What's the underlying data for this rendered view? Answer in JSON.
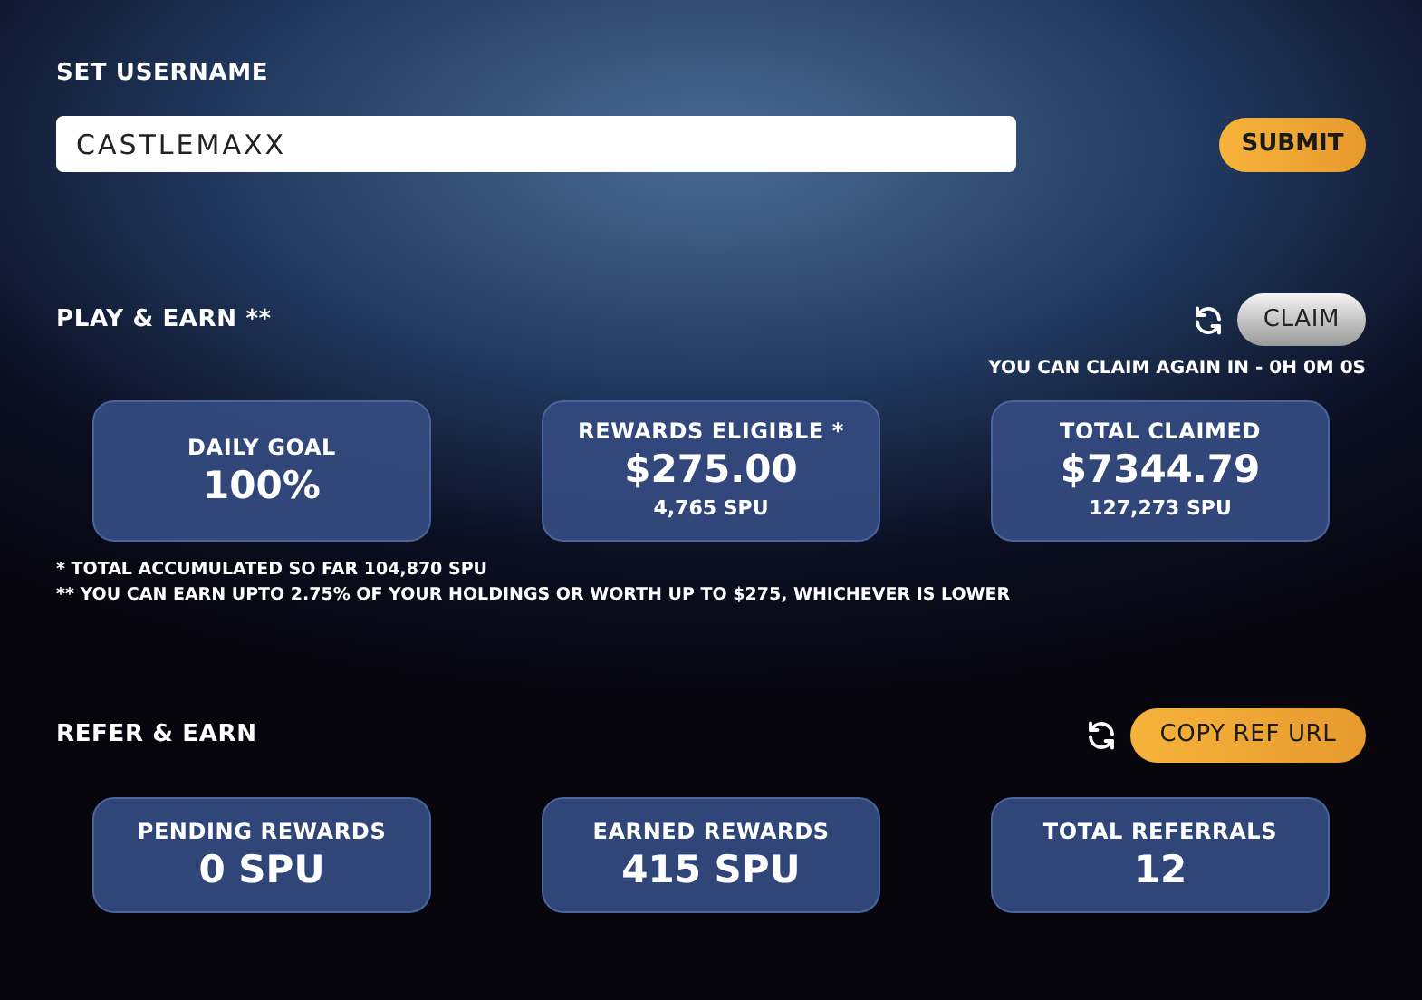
{
  "username": {
    "title": "SET USERNAME",
    "value": "CASTLEMAXX",
    "submit": "SUBMIT"
  },
  "play_earn": {
    "title": "PLAY & EARN **",
    "claim": "CLAIM",
    "claim_again": "YOU CAN CLAIM AGAIN IN - 0H 0M 0S",
    "cards": [
      {
        "label": "DAILY GOAL",
        "value": "100%"
      },
      {
        "label": "REWARDS ELIGIBLE *",
        "value": "$275.00",
        "sub": "4,765 SPU"
      },
      {
        "label": "TOTAL CLAIMED",
        "value": "$7344.79",
        "sub": "127,273 SPU"
      }
    ],
    "notes": [
      "* TOTAL ACCUMULATED SO FAR 104,870 SPU",
      "** YOU CAN EARN UPTO 2.75% OF YOUR HOLDINGS OR WORTH UP TO $275, WHICHEVER IS LOWER"
    ]
  },
  "refer_earn": {
    "title": "REFER & EARN",
    "copy": "COPY REF URL",
    "cards": [
      {
        "label": "PENDING REWARDS",
        "value": "0 SPU"
      },
      {
        "label": "EARNED REWARDS",
        "value": "415 SPU"
      },
      {
        "label": "TOTAL REFERRALS",
        "value": "12"
      }
    ]
  }
}
